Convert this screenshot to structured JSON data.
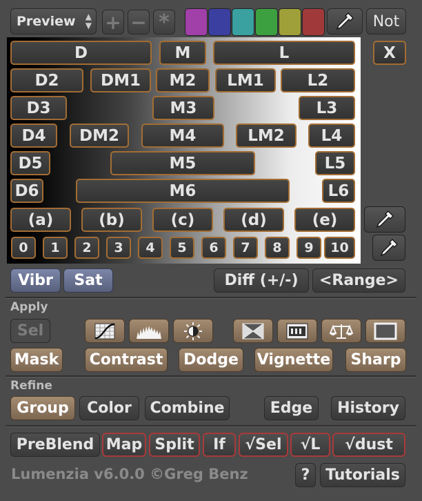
{
  "toolbar": {
    "preview_label": "Preview",
    "plus": "+",
    "minus": "−",
    "asterisk": "*",
    "swatches": [
      "#a040a8",
      "#3b3fa0",
      "#3aa0a0",
      "#3da040",
      "#a0a03a",
      "#a03a3a"
    ],
    "not_label": "Not"
  },
  "luminosity": {
    "rows": [
      [
        "D",
        "M",
        "L"
      ],
      [
        "D2",
        "DM1",
        "M2",
        "LM1",
        "L2"
      ],
      [
        "D3",
        "M3",
        "L3"
      ],
      [
        "D4",
        "DM2",
        "M4",
        "LM2",
        "L4"
      ],
      [
        "D5",
        "M5",
        "L5"
      ],
      [
        "D6",
        "M6",
        "L6"
      ]
    ],
    "zones": [
      "(a)",
      "(b)",
      "(c)",
      "(d)",
      "(e)"
    ],
    "numbers": [
      "0",
      "1",
      "2",
      "3",
      "4",
      "5",
      "6",
      "7",
      "8",
      "9",
      "10"
    ],
    "close_label": "X"
  },
  "controls": {
    "vibr_label": "Vibr",
    "sat_label": "Sat",
    "diff_label": "Diff (+/-)",
    "range_label": "<Range>"
  },
  "apply": {
    "heading": "Apply",
    "sel_label": "Sel",
    "mask_label": "Mask",
    "contrast_label": "Contrast",
    "dodge_label": "Dodge",
    "vignette_label": "Vignette",
    "sharp_label": "Sharp"
  },
  "refine": {
    "heading": "Refine",
    "group_label": "Group",
    "color_label": "Color",
    "combine_label": "Combine",
    "edge_label": "Edge",
    "history_label": "History"
  },
  "bottom": {
    "preblend_label": "PreBlend",
    "map_label": "Map",
    "split_label": "Split",
    "if_label": "If",
    "check_sel_label": "√Sel",
    "check_l_label": "√L",
    "check_dust_label": "√dust",
    "version_text": "Lumenzia v6.0.0 ©Greg Benz",
    "help_label": "?",
    "tutorials_label": "Tutorials"
  }
}
